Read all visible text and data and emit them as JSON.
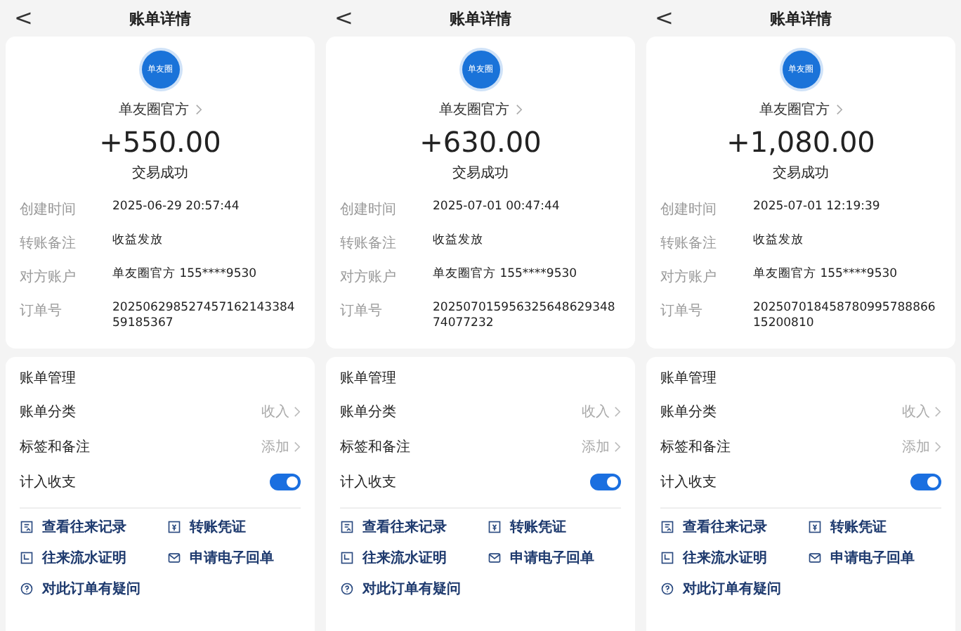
{
  "panels": [
    {
      "back": "<",
      "title": "账单详情",
      "logo_text": "单友圈",
      "payee": "单友圈官方",
      "amount": "+550.00",
      "status": "交易成功",
      "details": [
        {
          "label": "创建时间",
          "value": "2025-06-29 20:57:44"
        },
        {
          "label": "转账备注",
          "value": "收益发放"
        },
        {
          "label": "对方账户",
          "value": "单友圈官方 155****9530"
        },
        {
          "label": "订单号",
          "value": "20250629852745716214338459185367"
        }
      ],
      "management": {
        "title": "账单管理",
        "rows": [
          {
            "kind": "link",
            "label": "账单分类",
            "value": "收入"
          },
          {
            "kind": "link",
            "label": "标签和备注",
            "value": "添加"
          },
          {
            "kind": "toggle",
            "label": "计入收支",
            "on": true
          }
        ]
      },
      "actions": [
        {
          "kind": "record",
          "label": "查看往来记录"
        },
        {
          "kind": "voucher",
          "label": "转账凭证"
        },
        {
          "kind": "statement",
          "label": "往来流水证明"
        },
        {
          "kind": "mail",
          "label": "申请电子回单"
        },
        {
          "kind": "question",
          "label": "对此订单有疑问"
        }
      ]
    },
    {
      "back": "<",
      "title": "账单详情",
      "logo_text": "单友圈",
      "payee": "单友圈官方",
      "amount": "+630.00",
      "status": "交易成功",
      "details": [
        {
          "label": "创建时间",
          "value": "2025-07-01 00:47:44"
        },
        {
          "label": "转账备注",
          "value": "收益发放"
        },
        {
          "label": "对方账户",
          "value": "单友圈官方 155****9530"
        },
        {
          "label": "订单号",
          "value": "20250701595632564862934874077232"
        }
      ],
      "management": {
        "title": "账单管理",
        "rows": [
          {
            "kind": "link",
            "label": "账单分类",
            "value": "收入"
          },
          {
            "kind": "link",
            "label": "标签和备注",
            "value": "添加"
          },
          {
            "kind": "toggle",
            "label": "计入收支",
            "on": true
          }
        ]
      },
      "actions": [
        {
          "kind": "record",
          "label": "查看往来记录"
        },
        {
          "kind": "voucher",
          "label": "转账凭证"
        },
        {
          "kind": "statement",
          "label": "往来流水证明"
        },
        {
          "kind": "mail",
          "label": "申请电子回单"
        },
        {
          "kind": "question",
          "label": "对此订单有疑问"
        }
      ]
    },
    {
      "back": "<",
      "title": "账单详情",
      "logo_text": "单友圈",
      "payee": "单友圈官方",
      "amount": "+1,080.00",
      "status": "交易成功",
      "details": [
        {
          "label": "创建时间",
          "value": "2025-07-01 12:19:39"
        },
        {
          "label": "转账备注",
          "value": "收益发放"
        },
        {
          "label": "对方账户",
          "value": "单友圈官方 155****9530"
        },
        {
          "label": "订单号",
          "value": "20250701845878099578886615200810"
        }
      ],
      "management": {
        "title": "账单管理",
        "rows": [
          {
            "kind": "link",
            "label": "账单分类",
            "value": "收入"
          },
          {
            "kind": "link",
            "label": "标签和备注",
            "value": "添加"
          },
          {
            "kind": "toggle",
            "label": "计入收支",
            "on": true
          }
        ]
      },
      "actions": [
        {
          "kind": "record",
          "label": "查看往来记录"
        },
        {
          "kind": "voucher",
          "label": "转账凭证"
        },
        {
          "kind": "statement",
          "label": "往来流水证明"
        },
        {
          "kind": "mail",
          "label": "申请电子回单"
        },
        {
          "kind": "question",
          "label": "对此订单有疑问"
        }
      ]
    }
  ]
}
